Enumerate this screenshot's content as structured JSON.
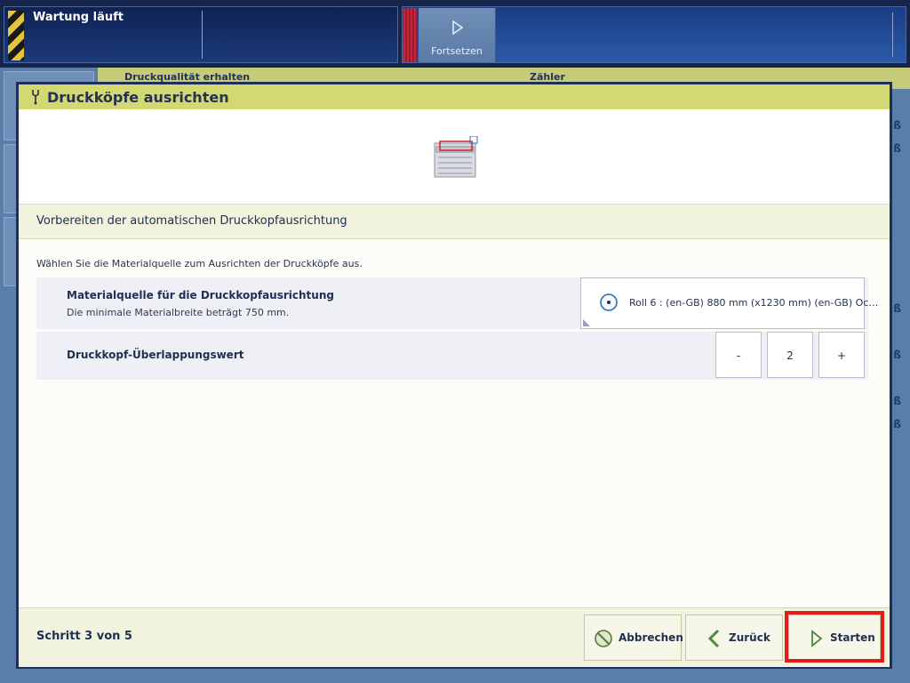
{
  "status_bar": {
    "title": "Wartung läuft",
    "continue_label": "Fortsetzen"
  },
  "background": {
    "tab_print_quality": "Druckqualität erhalten",
    "tab_counters": "Zähler",
    "row_texts": [
      "ß",
      "ß",
      "ß",
      "ß",
      "ß",
      "ß"
    ]
  },
  "dialog": {
    "title": "Druckköpfe ausrichten",
    "section_title": "Vorbereiten der automatischen Druckkopfausrichtung",
    "instruction": "Wählen Sie die Materialquelle zum Ausrichten der Druckköpfe aus.",
    "media_source": {
      "label": "Materialquelle für die Druckkopfausrichtung",
      "hint": "Die minimale Materialbreite beträgt 750 mm.",
      "selected_value": "Roll 6 : (en-GB) 880 mm (x1230 mm) (en-GB) Oc…"
    },
    "overlap": {
      "label": "Druckkopf-Überlappungswert",
      "minus": "-",
      "value": "2",
      "plus": "+"
    }
  },
  "footer": {
    "step_text": "Schritt 3 von 5",
    "cancel_label": "Abbrechen",
    "back_label": "Zurück",
    "start_label": "Starten"
  },
  "colors": {
    "header_accent": "#d4d872",
    "navy": "#1f3058",
    "highlight_red": "#e21b1b"
  }
}
